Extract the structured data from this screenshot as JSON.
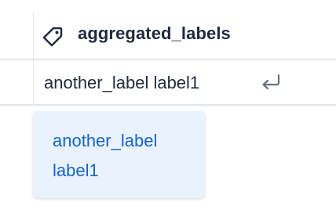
{
  "column": {
    "header_icon": "tag-icon",
    "header_label": "aggregated_labels"
  },
  "cell": {
    "value": "another_label label1",
    "action_icon": "enter-return-icon"
  },
  "popup": {
    "items": [
      {
        "label": "another_label"
      },
      {
        "label": "label1"
      }
    ]
  },
  "colors": {
    "header_text": "#1f2b3d",
    "link_text": "#1764c8",
    "popup_background": "#e9f2fd",
    "grid_line": "#e3e6ea"
  }
}
